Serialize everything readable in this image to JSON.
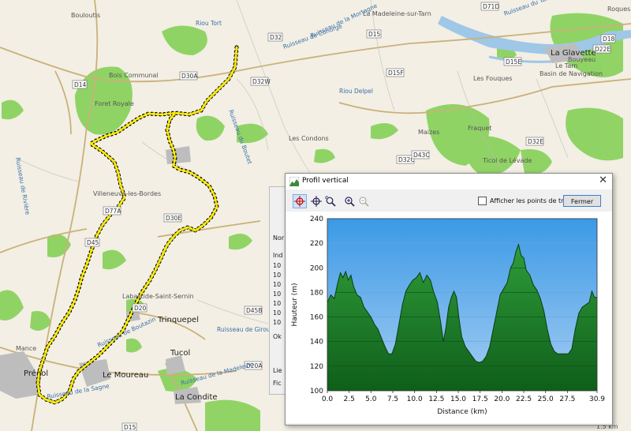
{
  "map": {
    "towns": [
      "Le Moureau",
      "Trinquepel",
      "Tucol",
      "La Condite",
      "La Glavette",
      "Prénol",
      "Mance",
      "Labastide-Saint-Sernin",
      "Villeneuve-les-Bordes",
      "Les Condons",
      "Fraquet",
      "Les Fouques",
      "Maizes",
      "Ticol de Lévade",
      "Bouloutis",
      "Foret Royale",
      "Bois Communal",
      "Le Tarn",
      "Bouyeau",
      "Basin de Navigation",
      "Roques",
      "La Madeleine-sur-Tarn"
    ],
    "roads": [
      "D14",
      "D30A",
      "D32",
      "D32W",
      "D15",
      "D15F",
      "D15E",
      "D32C",
      "D32E",
      "D71D",
      "D18",
      "D22E",
      "D45",
      "D45B",
      "D20",
      "D20A",
      "D30E",
      "D77A",
      "D43C",
      "D15"
    ],
    "streams": [
      "Ruisseau du Tarn",
      "Riou Tort",
      "Ruisseau de la Mortagne",
      "Ruisseau de Conorge",
      "Riou Delpel",
      "Ruisseau du Boutet",
      "Ruisseau de Rivière",
      "Ruisseau de la Sagne",
      "Ruisseau de Boutazin",
      "Ruisseau de la Madeleine",
      "Ruisseau de Girou"
    ],
    "scale": "1.5 km",
    "route_color": "#ffee00"
  },
  "background_window": {
    "labels": [
      "Nor",
      "Ind",
      "10",
      "10",
      "10",
      "10",
      "10",
      "10",
      "10",
      "Ok",
      "Lie",
      "Fic"
    ]
  },
  "dialog": {
    "title": "Profil vertical",
    "close": "✕",
    "checkbox_label": "Afficher les points de tracé",
    "close_button": "Fermer"
  },
  "chart_data": {
    "type": "area",
    "xlabel": "Distance   (km)",
    "ylabel": "Hauteur  (m)",
    "xlim": [
      0,
      30.9
    ],
    "ylim": [
      100,
      240
    ],
    "xticks": [
      "0.0",
      "2.5",
      "5.0",
      "7.5",
      "10.0",
      "12.5",
      "15.0",
      "17.5",
      "20.0",
      "22.5",
      "25.0",
      "27.5",
      "30.9"
    ],
    "yticks": [
      "100",
      "120",
      "140",
      "160",
      "180",
      "200",
      "220",
      "240"
    ],
    "grid": true,
    "fill_color": "#1f8a2e",
    "sky_color": "#4aa3e8",
    "x": [
      0,
      0.4,
      0.8,
      1.2,
      1.5,
      1.8,
      2.1,
      2.4,
      2.7,
      3.0,
      3.4,
      3.8,
      4.2,
      4.6,
      5.0,
      5.4,
      5.8,
      6.2,
      6.6,
      7.0,
      7.4,
      7.8,
      8.2,
      8.6,
      9.0,
      9.4,
      9.8,
      10.2,
      10.6,
      11.0,
      11.4,
      11.8,
      12.2,
      12.6,
      13.0,
      13.3,
      13.6,
      13.9,
      14.2,
      14.5,
      14.8,
      15.1,
      15.4,
      15.8,
      16.2,
      16.6,
      17.0,
      17.4,
      17.8,
      18.2,
      18.6,
      19.0,
      19.4,
      19.8,
      20.2,
      20.6,
      21.0,
      21.3,
      21.6,
      21.9,
      22.2,
      22.5,
      22.8,
      23.2,
      23.6,
      24.0,
      24.4,
      24.8,
      25.2,
      25.6,
      26.0,
      26.4,
      26.8,
      27.2,
      27.6,
      28.0,
      28.4,
      28.8,
      29.2,
      29.6,
      30.0,
      30.3,
      30.6,
      30.9
    ],
    "y": [
      172,
      178,
      175,
      188,
      196,
      192,
      197,
      190,
      194,
      185,
      178,
      176,
      168,
      164,
      160,
      154,
      150,
      143,
      136,
      130,
      130,
      138,
      154,
      170,
      181,
      186,
      190,
      192,
      196,
      188,
      194,
      190,
      180,
      172,
      155,
      140,
      152,
      168,
      176,
      181,
      176,
      158,
      144,
      136,
      132,
      128,
      124,
      123,
      124,
      128,
      136,
      150,
      164,
      178,
      183,
      188,
      200,
      204,
      213,
      219,
      210,
      208,
      198,
      194,
      186,
      182,
      175,
      165,
      150,
      138,
      132,
      130,
      130,
      130,
      130,
      134,
      150,
      163,
      168,
      170,
      172,
      181,
      176,
      176
    ]
  }
}
